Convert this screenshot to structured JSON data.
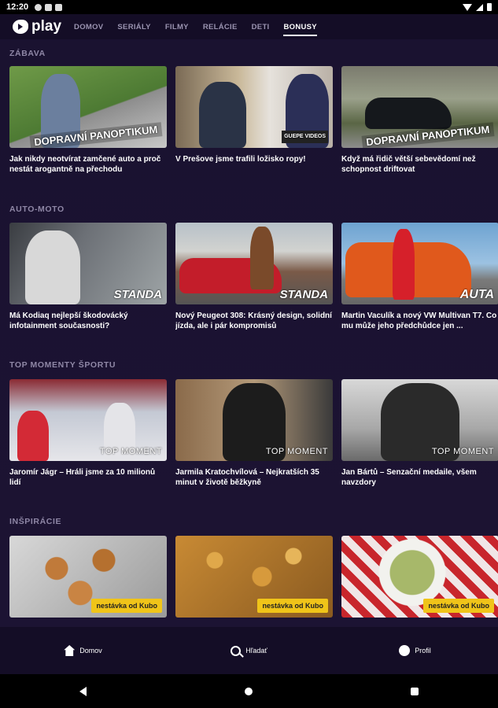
{
  "status": {
    "time": "12:20"
  },
  "app": {
    "logo_text": "play"
  },
  "nav": {
    "items": [
      "DOMOV",
      "SERIÁLY",
      "FILMY",
      "RELÁCIE",
      "DETI",
      "BONUSY"
    ],
    "active": "BONUSY"
  },
  "sections": [
    {
      "title": "ZÁBAVA",
      "cards": [
        {
          "title": "Jak nikdy neotvírat zamčené auto a proč nestát arogantně na přechodu",
          "badge": "DOPRAVNÍ PANOPTIKUM"
        },
        {
          "title": "V Prešove jsme trafili ložisko ropy!",
          "badge": "GUEPE VIDEOS"
        },
        {
          "title": "Když má řidič větší sebevědomí než schopnost driftovat",
          "badge": "DOPRAVNÍ PANOPTIKUM"
        }
      ]
    },
    {
      "title": "AUTO-MOTO",
      "cards": [
        {
          "title": "Má Kodiaq nejlepší škodovácký infotainment současnosti?",
          "badge": "STANDA"
        },
        {
          "title": "Nový Peugeot 308: Krásný design, solidní jízda, ale i pár kompromisů",
          "badge": "STANDA"
        },
        {
          "title": "Martin Vaculík a nový VW Multivan T7. Co mu může jeho předchůdce jen ...",
          "badge": "AUTA"
        }
      ]
    },
    {
      "title": "TOP MOMENTY ŠPORTU",
      "cards": [
        {
          "title": "Jaromír Jágr – Hráli jsme za 10 milionů lidí",
          "badge": "TOP MOMENT"
        },
        {
          "title": "Jarmila Kratochvílová – Nejkratších 35 minut v životě běžkyně",
          "badge": "TOP MOMENT"
        },
        {
          "title": "Jan Bártů – Senzační medaile, všem navzdory",
          "badge": "TOP MOMENT"
        }
      ]
    },
    {
      "title": "INŠPIRÁCIE",
      "cards": [
        {
          "title": "",
          "badge": "nestávka od Kubo"
        },
        {
          "title": "",
          "badge": "nestávka od Kubo"
        },
        {
          "title": "",
          "badge": "nestávka od Kubo"
        }
      ]
    }
  ],
  "bottom_nav": {
    "home": "Domov",
    "search": "Hľadať",
    "profile": "Profil"
  }
}
